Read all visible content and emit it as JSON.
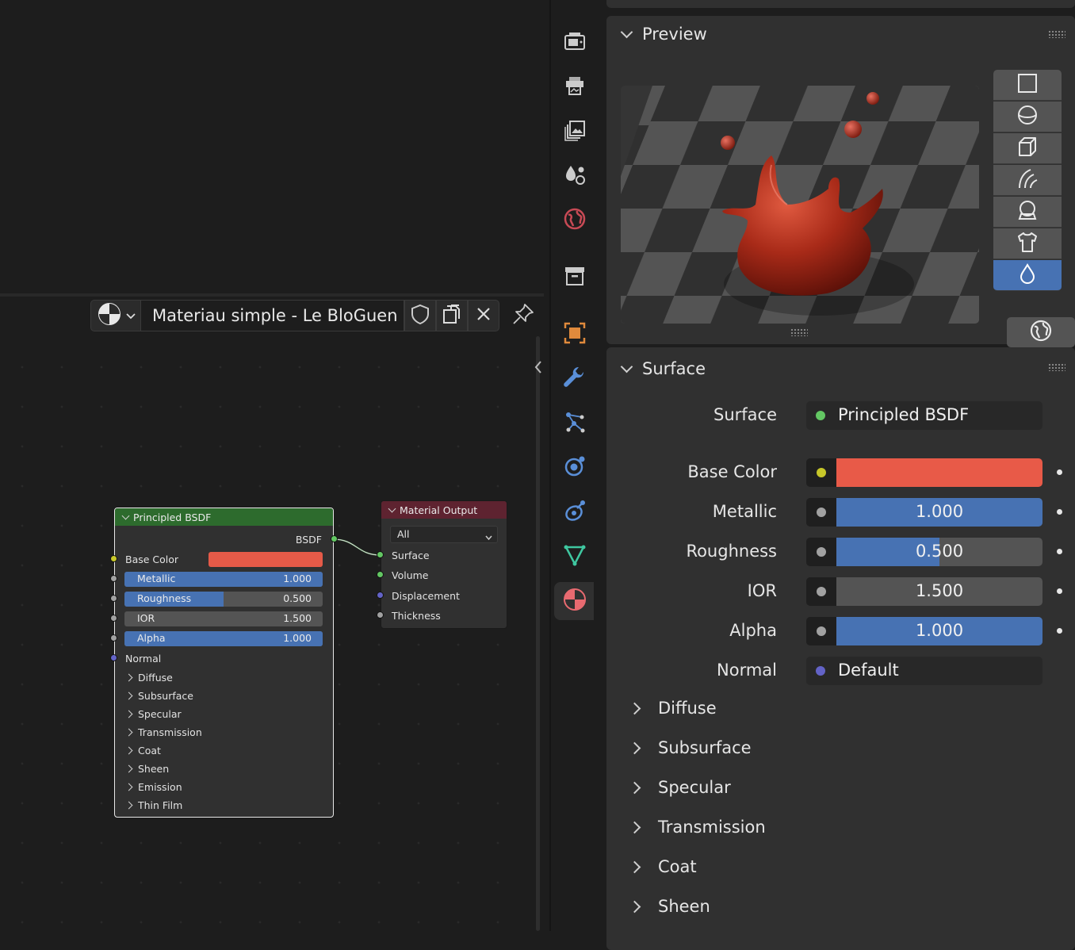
{
  "node_editor": {
    "material_name": "Materiau simple - Le BloGuen",
    "principled_node": {
      "title": "Principled BSDF",
      "output_label": "BSDF",
      "base_color_label": "Base Color",
      "base_color": "#e55a48",
      "inputs": [
        {
          "label": "Metallic",
          "value": "1.000",
          "fraction": 1.0
        },
        {
          "label": "Roughness",
          "value": "0.500",
          "fraction": 0.5
        },
        {
          "label": "IOR",
          "value": "1.500",
          "fraction": 0.0
        },
        {
          "label": "Alpha",
          "value": "1.000",
          "fraction": 1.0
        }
      ],
      "normal_label": "Normal",
      "panels": [
        "Diffuse",
        "Subsurface",
        "Specular",
        "Transmission",
        "Coat",
        "Sheen",
        "Emission",
        "Thin Film"
      ]
    },
    "output_node": {
      "title": "Material Output",
      "target": "All",
      "inputs": [
        "Surface",
        "Volume",
        "Displacement",
        "Thickness"
      ]
    }
  },
  "tabs": [
    {
      "name": "render",
      "icon": "camera-back-icon"
    },
    {
      "name": "output",
      "icon": "printer-icon"
    },
    {
      "name": "view-layer",
      "icon": "image-stack-icon"
    },
    {
      "name": "scene",
      "icon": "scene-icon"
    },
    {
      "name": "world",
      "icon": "world-icon"
    },
    {
      "name": "collection",
      "icon": "collection-box-icon"
    },
    {
      "name": "object",
      "icon": "object-square-icon"
    },
    {
      "name": "modifiers",
      "icon": "wrench-icon"
    },
    {
      "name": "particles",
      "icon": "particles-icon"
    },
    {
      "name": "physics",
      "icon": "physics-orbit-icon"
    },
    {
      "name": "constraints",
      "icon": "constraint-icon"
    },
    {
      "name": "data",
      "icon": "mesh-triangle-icon"
    },
    {
      "name": "material",
      "icon": "material-sphere-icon",
      "active": true
    }
  ],
  "properties": {
    "preview": {
      "title": "Preview",
      "shapes": [
        "plane-icon",
        "sphere-icon",
        "cube-icon",
        "hair-icon",
        "shader-ball-icon",
        "cloth-icon",
        "fluid-drop-icon"
      ],
      "active_shape": "fluid-drop-icon"
    },
    "surface": {
      "title": "Surface",
      "surface_label": "Surface",
      "surface_value": "Principled BSDF",
      "base_color_label": "Base Color",
      "base_color": "#e85a48",
      "inputs": [
        {
          "label": "Metallic",
          "value": "1.000",
          "fraction": 1.0
        },
        {
          "label": "Roughness",
          "value": "0.500",
          "fraction": 0.5
        },
        {
          "label": "IOR",
          "value": "1.500",
          "fraction": 0.0
        },
        {
          "label": "Alpha",
          "value": "1.000",
          "fraction": 1.0
        }
      ],
      "normal_label": "Normal",
      "normal_value": "Default",
      "subpanels": [
        "Diffuse",
        "Subsurface",
        "Specular",
        "Transmission",
        "Coat",
        "Sheen"
      ]
    }
  },
  "colors": {
    "accent_blue": "#4772b3",
    "field_grey": "#545454",
    "node_header_green": "#2d6b2d",
    "node_header_output": "#5e2330"
  }
}
